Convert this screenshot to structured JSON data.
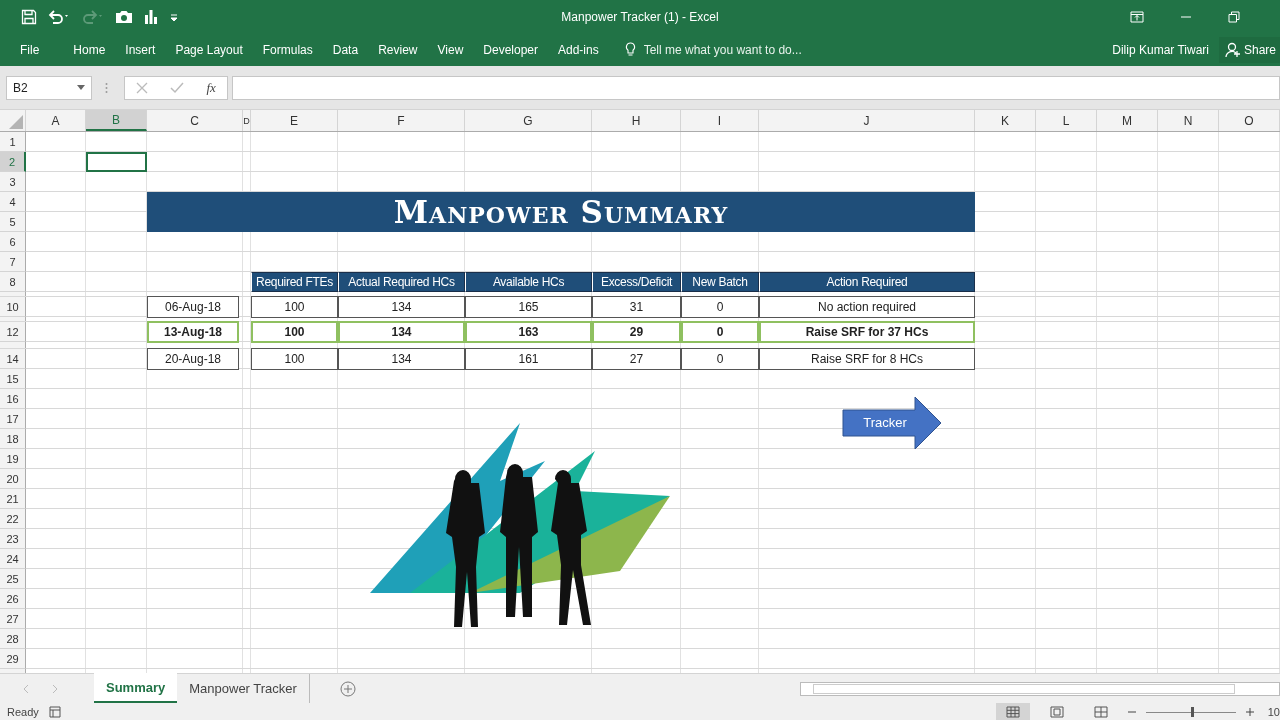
{
  "window": {
    "title": "Manpower Tracker (1) - Excel"
  },
  "ribbon": {
    "tabs": [
      "File",
      "Home",
      "Insert",
      "Page Layout",
      "Formulas",
      "Data",
      "Review",
      "View",
      "Developer",
      "Add-ins"
    ],
    "tell_me": {
      "placeholder": "Tell me what you want to do..."
    },
    "user": "Dilip Kumar Tiwari",
    "share": "Share"
  },
  "formula_bar": {
    "name_box": "B2",
    "fx": "fx"
  },
  "columns": [
    {
      "label": "A",
      "selected": false
    },
    {
      "label": "B",
      "selected": true
    },
    {
      "label": "C",
      "selected": false
    },
    {
      "label": "D",
      "selected": false
    },
    {
      "label": "E",
      "selected": false
    },
    {
      "label": "F",
      "selected": false
    },
    {
      "label": "G",
      "selected": false
    },
    {
      "label": "H",
      "selected": false
    },
    {
      "label": "I",
      "selected": false
    },
    {
      "label": "J",
      "selected": false
    },
    {
      "label": "K",
      "selected": false
    },
    {
      "label": "L",
      "selected": false
    },
    {
      "label": "M",
      "selected": false
    },
    {
      "label": "N",
      "selected": false
    },
    {
      "label": "O",
      "selected": false
    }
  ],
  "rows": [
    {
      "label": "1",
      "selected": false
    },
    {
      "label": "2",
      "selected": true
    },
    {
      "label": "3",
      "selected": false
    },
    {
      "label": "4",
      "selected": false
    },
    {
      "label": "5",
      "selected": false
    },
    {
      "label": "6",
      "selected": false
    },
    {
      "label": "7",
      "selected": false
    },
    {
      "label": "8",
      "selected": false
    },
    {
      "label": "10",
      "selected": false
    },
    {
      "label": "12",
      "selected": false
    },
    {
      "label": "14",
      "selected": false
    },
    {
      "label": "15",
      "selected": false
    },
    {
      "label": "16",
      "selected": false
    },
    {
      "label": "17",
      "selected": false
    },
    {
      "label": "18",
      "selected": false
    },
    {
      "label": "19",
      "selected": false
    },
    {
      "label": "20",
      "selected": false
    },
    {
      "label": "21",
      "selected": false
    },
    {
      "label": "22",
      "selected": false
    },
    {
      "label": "23",
      "selected": false
    },
    {
      "label": "24",
      "selected": false
    },
    {
      "label": "25",
      "selected": false
    },
    {
      "label": "26",
      "selected": false
    },
    {
      "label": "27",
      "selected": false
    },
    {
      "label": "28",
      "selected": false
    },
    {
      "label": "29",
      "selected": false
    }
  ],
  "banner": "Manpower Summary",
  "table": {
    "columns": [
      "Required FTEs",
      "Actual Required HCs",
      "Available HCs",
      "Excess/Deficit",
      "New Batch",
      "Action Required"
    ],
    "rows": [
      {
        "date": "06-Aug-18",
        "cells": [
          "100",
          "134",
          "165",
          "31",
          "0",
          "No action required"
        ],
        "highlighted": false
      },
      {
        "date": "13-Aug-18",
        "cells": [
          "100",
          "134",
          "163",
          "29",
          "0",
          "Raise SRF for 37 HCs"
        ],
        "highlighted": true
      },
      {
        "date": "20-Aug-18",
        "cells": [
          "100",
          "134",
          "161",
          "27",
          "0",
          "Raise SRF for 8 HCs"
        ],
        "highlighted": false
      }
    ]
  },
  "shape": {
    "label": "Tracker"
  },
  "sheet_tabs": [
    {
      "label": "Summary",
      "selected": true
    },
    {
      "label": "Manpower Tracker",
      "selected": false
    }
  ],
  "status_bar": {
    "status": "Ready",
    "zoom": {
      "level": 0.5,
      "percent": "10"
    }
  }
}
